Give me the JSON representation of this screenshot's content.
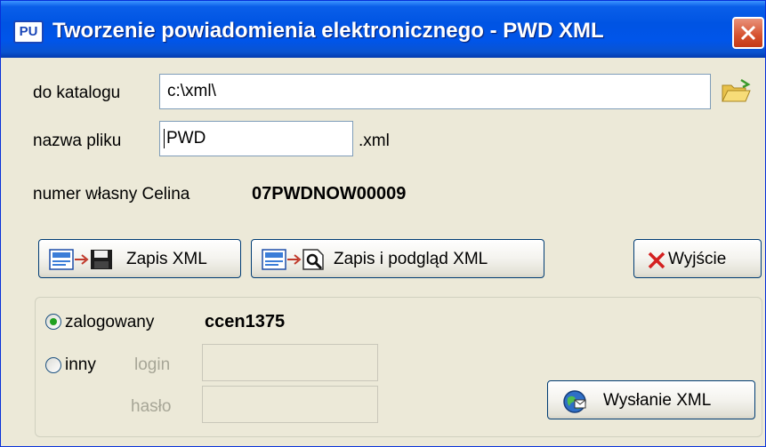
{
  "window": {
    "title": "Tworzenie powiadomienia elektronicznego - PWD XML",
    "app_icon_text": "PU",
    "colors": {
      "titlebar": "#0054e3",
      "close": "#d6512e",
      "body": "#ece9d8",
      "radio_selected": "#21a121"
    }
  },
  "form": {
    "directory_label": "do katalogu",
    "directory_value": "c:\\xml\\",
    "filename_label": "nazwa pliku",
    "filename_value": "PWD",
    "extension": ".xml",
    "own_number_label": "numer własny Celina",
    "own_number_value": "07PWDNOW00009"
  },
  "buttons": {
    "save_xml": "Zapis XML",
    "save_preview_xml": "Zapis i podgląd XML",
    "exit": "Wyjście",
    "send_xml": "Wysłanie XML"
  },
  "login": {
    "logged_in_label": "zalogowany",
    "logged_in_user": "ccen1375",
    "other_label": "inny",
    "login_label": "login",
    "password_label": "hasło",
    "selected": "zalogowany"
  },
  "icons": [
    "app-icon",
    "close-icon",
    "folder-open-icon",
    "xml-document-icon",
    "arrow-icon",
    "floppy-disk-icon",
    "magnifier-document-icon",
    "red-x-icon",
    "globe-send-icon"
  ]
}
